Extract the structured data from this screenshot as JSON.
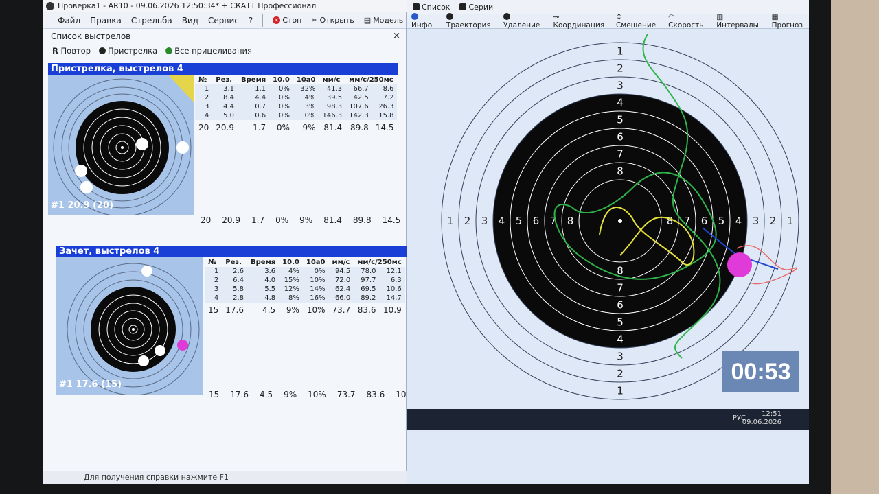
{
  "window": {
    "title": "Проверка1 - AR10 - 09.06.2026 12:50:34* + СКАТТ Профессионал"
  },
  "menu": [
    "Файл",
    "Правка",
    "Стрельба",
    "Вид",
    "Сервис",
    "?"
  ],
  "toolbar": {
    "stop": "Стоп",
    "open": "Открыть",
    "model": "Модель"
  },
  "right_tabs": {
    "list": "Список",
    "series": "Серии"
  },
  "right_tools": [
    "Инфо",
    "Траектория",
    "Удаление",
    "Координация",
    "Смещение",
    "Скорость",
    "Интервалы",
    "Прогноз"
  ],
  "shot_list": {
    "title": "Список выстрелов",
    "close": "×"
  },
  "sub_tabs": {
    "repeat": "Повтор",
    "sighting": "Пристрелка",
    "all": "Все прицеливания"
  },
  "card1": {
    "title": "Пристрелка, выстрелов 4",
    "label": "#1 20.9 (20)",
    "headers": [
      "№",
      "Рез.",
      "Время",
      "10.0",
      "10a0",
      "мм/с",
      "мм/с/250мс"
    ],
    "rows": [
      [
        "1",
        "3.1",
        "1.1",
        "0%",
        "32%",
        "41.3",
        "66.7",
        "8.6"
      ],
      [
        "2",
        "8.4",
        "4.4",
        "0%",
        "4%",
        "39.5",
        "42.5",
        "7.2"
      ],
      [
        "3",
        "4.4",
        "0.7",
        "0%",
        "3%",
        "98.3",
        "107.6",
        "26.3"
      ],
      [
        "4",
        "5.0",
        "0.6",
        "0%",
        "0%",
        "146.3",
        "142.3",
        "15.8"
      ]
    ],
    "summary": [
      "20",
      "20.9",
      "1.7",
      "0%",
      "9%",
      "81.4",
      "89.8",
      "14.5"
    ],
    "footer": [
      "20",
      "20.9",
      "1.7",
      "0%",
      "9%",
      "81.4",
      "89.8",
      "14.5"
    ]
  },
  "card2": {
    "title": "Зачет, выстрелов 4",
    "label": "#1 17.6 (15)",
    "headers": [
      "№",
      "Рез.",
      "Время",
      "10.0",
      "10a0",
      "мм/с",
      "мм/с/250мс"
    ],
    "rows": [
      [
        "1",
        "2.6",
        "3.6",
        "4%",
        "0%",
        "94.5",
        "78.0",
        "12.1"
      ],
      [
        "2",
        "6.4",
        "4.0",
        "15%",
        "10%",
        "72.0",
        "97.7",
        "6.3"
      ],
      [
        "3",
        "5.8",
        "5.5",
        "12%",
        "14%",
        "62.4",
        "69.5",
        "10.6"
      ],
      [
        "4",
        "2.8",
        "4.8",
        "8%",
        "16%",
        "66.0",
        "89.2",
        "14.7"
      ]
    ],
    "summary": [
      "15",
      "17.6",
      "4.5",
      "9%",
      "10%",
      "73.7",
      "83.6",
      "10.9"
    ],
    "footer": [
      "15",
      "17.6",
      "4.5",
      "9%",
      "10%",
      "73.7",
      "83.6",
      "10.9"
    ]
  },
  "big_target": {
    "ring_numbers": [
      "1",
      "2",
      "3",
      "4",
      "5",
      "6",
      "7",
      "8"
    ]
  },
  "timer": "00:53",
  "status": "Для получения справки нажмите F1",
  "tray": {
    "lang": "РУС",
    "time": "12:51",
    "date": "09.06.2026"
  },
  "colors": {
    "header_blue": "#1a3fd6",
    "target_bg": "#a9c4e9",
    "trace_green": "#2fb54a",
    "trace_yellow": "#e6e23a",
    "shot_magenta": "#e03ad8"
  }
}
